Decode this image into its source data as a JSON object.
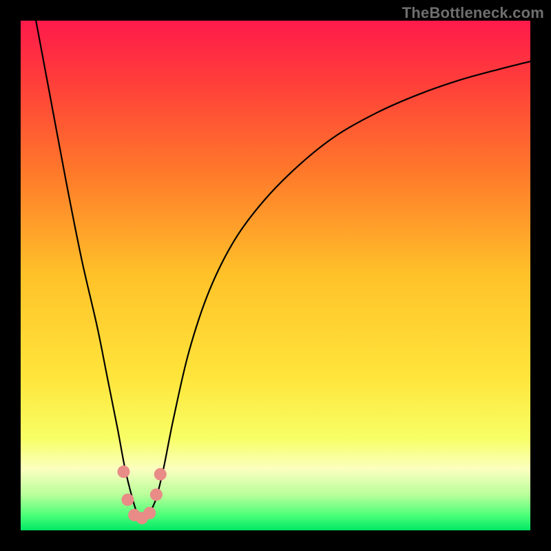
{
  "watermark": "TheBottleneck.com",
  "chart_data": {
    "type": "line",
    "title": "",
    "xlabel": "",
    "ylabel": "",
    "xlim": [
      0,
      100
    ],
    "ylim": [
      0,
      100
    ],
    "background_gradient": {
      "stops": [
        {
          "offset": 0.0,
          "color": "#ff1a4b"
        },
        {
          "offset": 0.12,
          "color": "#ff3e3a"
        },
        {
          "offset": 0.3,
          "color": "#ff7a2a"
        },
        {
          "offset": 0.5,
          "color": "#ffc229"
        },
        {
          "offset": 0.7,
          "color": "#ffe53b"
        },
        {
          "offset": 0.82,
          "color": "#f7ff66"
        },
        {
          "offset": 0.88,
          "color": "#fbffc0"
        },
        {
          "offset": 0.93,
          "color": "#b9ff9a"
        },
        {
          "offset": 0.97,
          "color": "#4dff79"
        },
        {
          "offset": 1.0,
          "color": "#00e765"
        }
      ]
    },
    "series": [
      {
        "name": "bottleneck-curve",
        "stroke": "#000000",
        "stroke_width": 2.2,
        "x": [
          3,
          6,
          9,
          12,
          15,
          17,
          19,
          20.5,
          22,
          23,
          24,
          25,
          26.5,
          28,
          30,
          33,
          37,
          42,
          48,
          55,
          62,
          70,
          78,
          86,
          94,
          100
        ],
        "y": [
          100,
          84,
          68,
          53,
          40,
          30,
          20,
          12,
          6,
          3,
          2,
          3,
          6,
          12,
          22,
          35,
          47,
          57,
          65,
          72,
          77.5,
          82,
          85.5,
          88.3,
          90.5,
          92
        ]
      }
    ],
    "markers": {
      "name": "highlight-points",
      "fill": "#e98b87",
      "radius": 9,
      "points": [
        {
          "x": 20.2,
          "y": 11.5
        },
        {
          "x": 21.0,
          "y": 6.0
        },
        {
          "x": 22.3,
          "y": 3.0
        },
        {
          "x": 23.8,
          "y": 2.4
        },
        {
          "x": 25.3,
          "y": 3.4
        },
        {
          "x": 26.6,
          "y": 7.0
        },
        {
          "x": 27.4,
          "y": 11.0
        }
      ]
    }
  }
}
